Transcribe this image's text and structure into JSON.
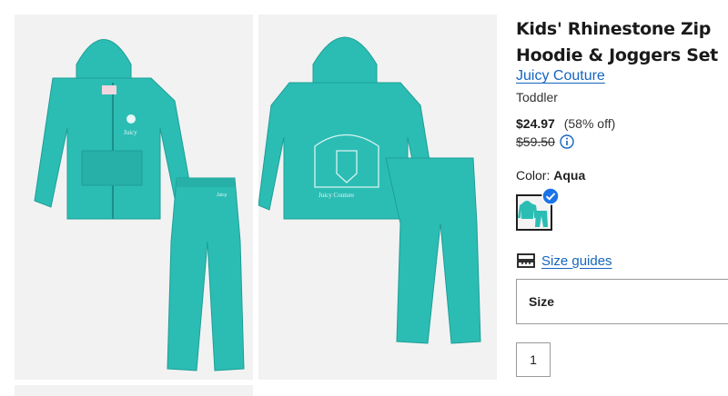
{
  "product": {
    "title": "Kids' Rhinestone Zip Hoodie & Joggers Set",
    "brand": "Juicy Couture",
    "age_group": "Toddler",
    "price": "$24.97",
    "discount": "(58% off)",
    "original_price": "$59.50"
  },
  "color": {
    "label": "Color:",
    "value": "Aqua",
    "swatch_color": "#2bb8b0"
  },
  "size_guides": {
    "label": "Size guides"
  },
  "size_select": {
    "label": "Size"
  },
  "quantity": {
    "value": "1"
  },
  "colors": {
    "link": "#1565c0",
    "garment": "#2bbdb4",
    "garment_dark": "#1e9e97",
    "check": "#1a73e8"
  }
}
